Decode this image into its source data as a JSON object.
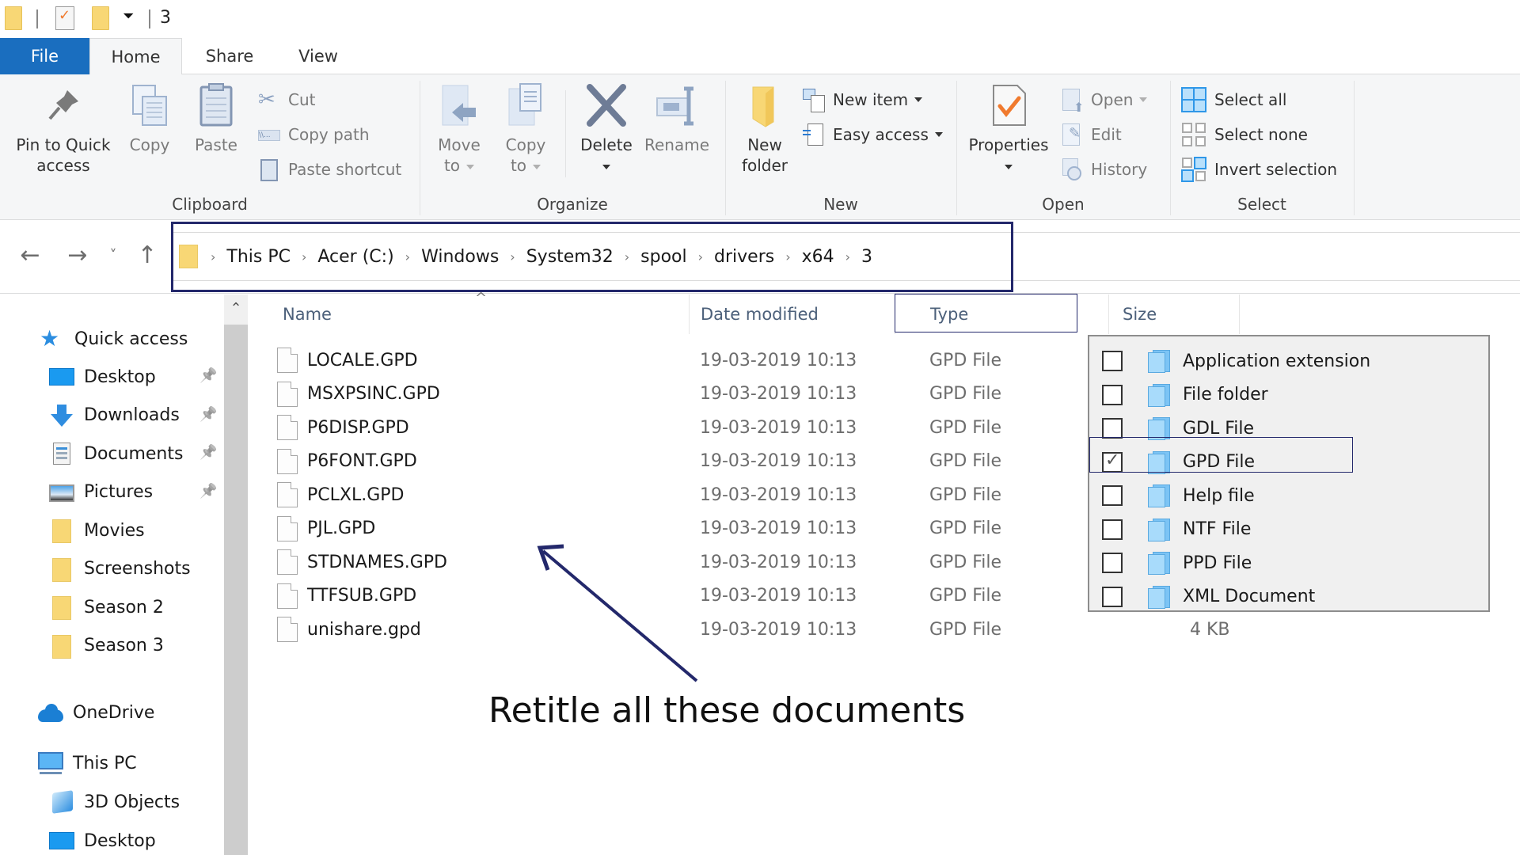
{
  "window": {
    "title": "3",
    "quick_access_toolbar": [
      "folder-icon",
      "properties-icon",
      "new-folder-icon",
      "customize-dropdown-icon"
    ]
  },
  "tabs": [
    {
      "label": "File",
      "active": false
    },
    {
      "label": "Home",
      "active": true
    },
    {
      "label": "Share",
      "active": false
    },
    {
      "label": "View",
      "active": false
    }
  ],
  "ribbon": {
    "clipboard": {
      "label": "Clipboard",
      "pin": "Pin to Quick access",
      "pin_line1": "Pin to Quick",
      "pin_line2": "access",
      "copy": "Copy",
      "paste": "Paste",
      "cut": "Cut",
      "copy_path": "Copy path",
      "paste_shortcut": "Paste shortcut"
    },
    "organize": {
      "label": "Organize",
      "move_to_1": "Move",
      "move_to_2": "to",
      "copy_to_1": "Copy",
      "copy_to_2": "to",
      "delete": "Delete",
      "rename": "Rename"
    },
    "new": {
      "label": "New",
      "new_folder_1": "New",
      "new_folder_2": "folder",
      "new_item": "New item",
      "easy_access": "Easy access"
    },
    "open": {
      "label": "Open",
      "properties": "Properties",
      "open": "Open",
      "edit": "Edit",
      "history": "History"
    },
    "select": {
      "label": "Select",
      "select_all": "Select all",
      "select_none": "Select none",
      "invert_selection": "Invert selection"
    }
  },
  "address": {
    "back": "←",
    "forward": "→",
    "recent": "˅",
    "up": "↑",
    "breadcrumbs": [
      "This PC",
      "Acer (C:)",
      "Windows",
      "System32",
      "spool",
      "drivers",
      "x64",
      "3"
    ]
  },
  "sidebar": {
    "quick_access": "Quick access",
    "items": [
      {
        "label": "Desktop",
        "icon": "desktop-icon",
        "pinned": true
      },
      {
        "label": "Downloads",
        "icon": "downloads-icon",
        "pinned": true
      },
      {
        "label": "Documents",
        "icon": "documents-icon",
        "pinned": true
      },
      {
        "label": "Pictures",
        "icon": "pictures-icon",
        "pinned": true
      },
      {
        "label": "Movies",
        "icon": "folder-icon",
        "pinned": false
      },
      {
        "label": "Screenshots",
        "icon": "folder-icon",
        "pinned": false
      },
      {
        "label": "Season 2",
        "icon": "folder-icon",
        "pinned": false
      },
      {
        "label": "Season 3",
        "icon": "folder-icon",
        "pinned": false
      }
    ],
    "onedrive": "OneDrive",
    "this_pc": "This PC",
    "this_pc_items": [
      {
        "label": "3D Objects",
        "icon": "3d-objects-icon"
      },
      {
        "label": "Desktop",
        "icon": "desktop-icon"
      }
    ]
  },
  "file_list": {
    "columns": {
      "name": "Name",
      "date": "Date modified",
      "type": "Type",
      "size": "Size"
    },
    "files": [
      {
        "name": "LOCALE.GPD",
        "date": "19-03-2019 10:13",
        "type": "GPD File",
        "size": ""
      },
      {
        "name": "MSXPSINC.GPD",
        "date": "19-03-2019 10:13",
        "type": "GPD File",
        "size": ""
      },
      {
        "name": "P6DISP.GPD",
        "date": "19-03-2019 10:13",
        "type": "GPD File",
        "size": ""
      },
      {
        "name": "P6FONT.GPD",
        "date": "19-03-2019 10:13",
        "type": "GPD File",
        "size": ""
      },
      {
        "name": "PCLXL.GPD",
        "date": "19-03-2019 10:13",
        "type": "GPD File",
        "size": ""
      },
      {
        "name": "PJL.GPD",
        "date": "19-03-2019 10:13",
        "type": "GPD File",
        "size": ""
      },
      {
        "name": "STDNAMES.GPD",
        "date": "19-03-2019 10:13",
        "type": "GPD File",
        "size": ""
      },
      {
        "name": "TTFSUB.GPD",
        "date": "19-03-2019 10:13",
        "type": "GPD File",
        "size": ""
      },
      {
        "name": "unishare.gpd",
        "date": "19-03-2019 10:13",
        "type": "GPD File",
        "size": "4 KB"
      }
    ]
  },
  "type_filter": {
    "options": [
      {
        "label": "Application extension",
        "checked": false
      },
      {
        "label": "File folder",
        "checked": false
      },
      {
        "label": "GDL File",
        "checked": false
      },
      {
        "label": "GPD File",
        "checked": true
      },
      {
        "label": "Help file",
        "checked": false
      },
      {
        "label": "NTF File",
        "checked": false
      },
      {
        "label": "PPD File",
        "checked": false
      },
      {
        "label": "XML Document",
        "checked": false
      }
    ]
  },
  "annotation": {
    "text": "Retitle all these documents",
    "color": "#23286b"
  },
  "colors": {
    "file_tab": "#1a6ebf",
    "ribbon_bg": "#f5f6f7",
    "folder": "#f8d775",
    "annotation": "#23286b",
    "header_text": "#4c607a"
  }
}
